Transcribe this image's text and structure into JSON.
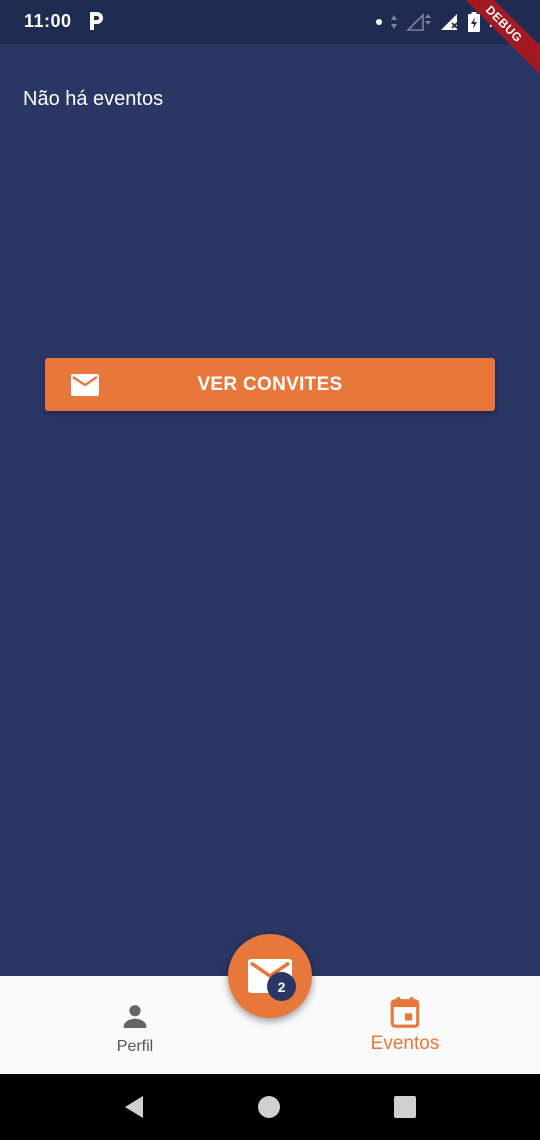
{
  "status_bar": {
    "time": "11:00",
    "app_icon": "p-icon",
    "battery_percent": "75%",
    "debug_banner": "DEBUG"
  },
  "main": {
    "empty_message": "Não há eventos",
    "ver_convites_label": "VER CONVITES",
    "ver_convites_icon": "mail-icon"
  },
  "fab": {
    "icon": "mail-icon",
    "badge_count": "2"
  },
  "bottom_nav": {
    "items": [
      {
        "label": "Perfil",
        "icon": "person-icon",
        "active": false
      },
      {
        "label": "Eventos",
        "icon": "calendar-icon",
        "active": true
      }
    ]
  },
  "colors": {
    "background": "#2a3764",
    "status_bar": "#1f2b51",
    "accent": "#e8773c",
    "nav_background": "#fafafa",
    "nav_inactive": "#555555"
  }
}
